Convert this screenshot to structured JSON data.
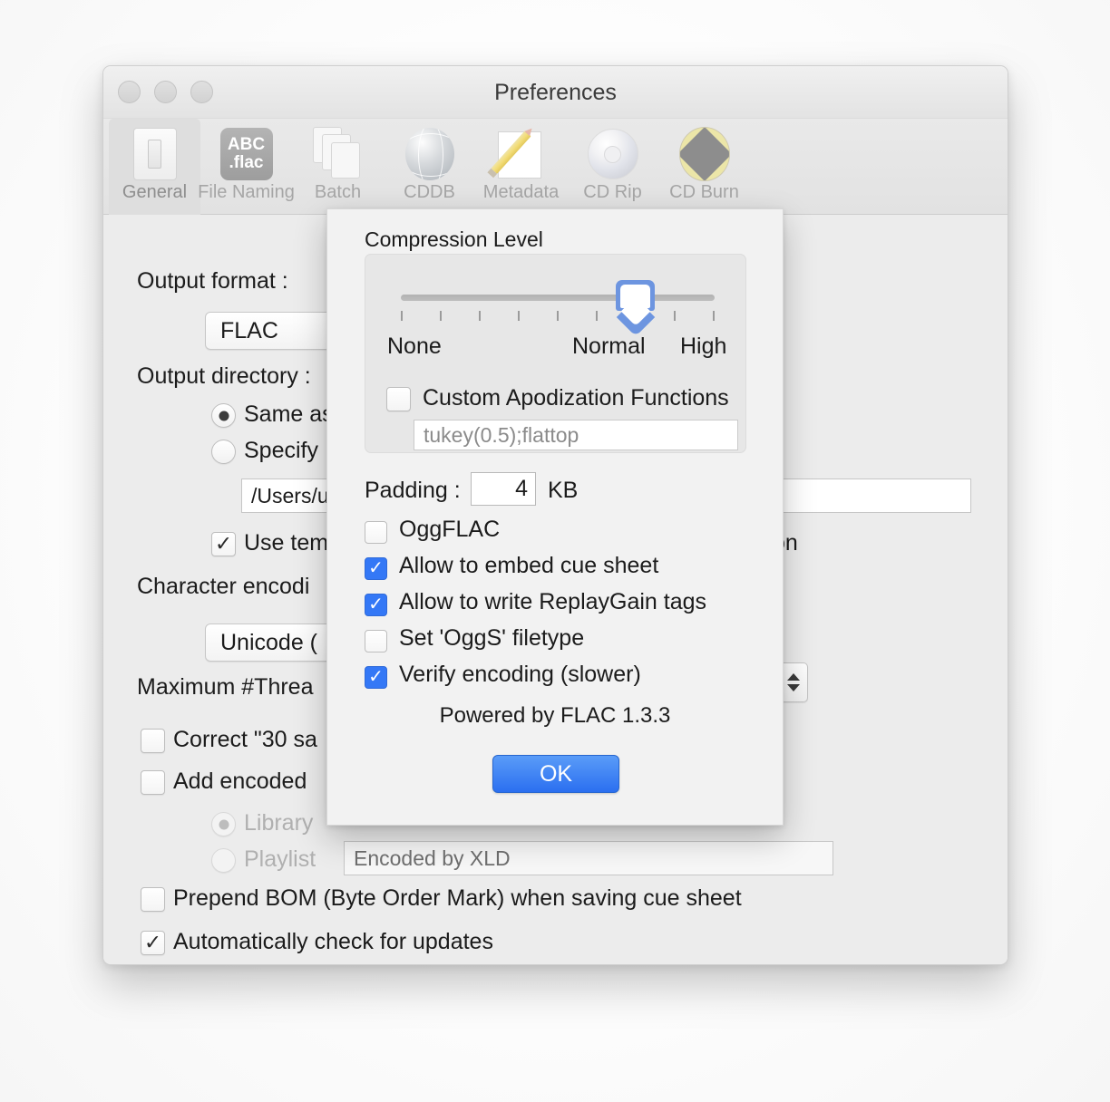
{
  "window": {
    "title": "Preferences",
    "traffic_lights": [
      "close",
      "minimize",
      "zoom"
    ]
  },
  "toolbar": {
    "items": [
      {
        "label": "General",
        "icon": "light-switch-icon",
        "selected": true
      },
      {
        "label": "File Naming",
        "icon": "abc-flac-icon",
        "selected": false
      },
      {
        "label": "Batch",
        "icon": "stacked-documents-icon",
        "selected": false
      },
      {
        "label": "CDDB",
        "icon": "globe-icon",
        "selected": false
      },
      {
        "label": "Metadata",
        "icon": "pencil-sheet-icon",
        "selected": false
      },
      {
        "label": "CD Rip",
        "icon": "compact-disc-icon",
        "selected": false
      },
      {
        "label": "CD Burn",
        "icon": "burn-disc-icon",
        "selected": false
      }
    ],
    "flac_icon_line1": "ABC",
    "flac_icon_line2": ".flac"
  },
  "general_pane": {
    "output_format_label": "Output format :",
    "output_format_value": "FLAC",
    "output_directory_label": "Output directory :",
    "radio_same_as_label": "Same as",
    "radio_specify_label": "Specify",
    "output_path_value": "/Users/u",
    "use_temp_label": "Use tem",
    "character_encoding_label": "Character encodi",
    "character_encoding_value": "Unicode (",
    "max_threads_label": "Maximum #Threa",
    "correct_30_label": "Correct \"30 sa",
    "add_encoded_label": "Add encoded ",
    "library_label": "Library",
    "playlist_label": "Playlist",
    "comment_value": "Encoded by XLD",
    "prepend_bom_label": "Prepend BOM (Byte Order Mark) when saving cue sheet",
    "auto_update_label": "Automatically check for updates",
    "partial_right_text": "on"
  },
  "flac_dialog": {
    "title": "Compression Level",
    "slider": {
      "tick_count": 9,
      "value_index": 6,
      "labels": {
        "min": "None",
        "mid": "Normal",
        "max": "High"
      }
    },
    "custom_apodization_label": "Custom Apodization Functions",
    "custom_apodization_checked": false,
    "apodization_value": "tukey(0.5);flattop",
    "padding_label": "Padding :",
    "padding_value": "4",
    "padding_unit": "KB",
    "options": [
      {
        "label": "OggFLAC",
        "checked": false
      },
      {
        "label": "Allow to embed cue sheet",
        "checked": true
      },
      {
        "label": "Allow to write ReplayGain tags",
        "checked": true
      },
      {
        "label": "Set 'OggS' filetype",
        "checked": false
      },
      {
        "label": "Verify encoding (slower)",
        "checked": true
      }
    ],
    "powered_by": "Powered by FLAC 1.3.3",
    "ok_label": "OK"
  },
  "colors": {
    "accent_blue": "#3478f6",
    "ok_button_blue": "#2b6ff0",
    "slider_thumb_blue": "#6d95e0",
    "window_bg": "#ececec",
    "dialog_bg": "#f2f2f2"
  }
}
